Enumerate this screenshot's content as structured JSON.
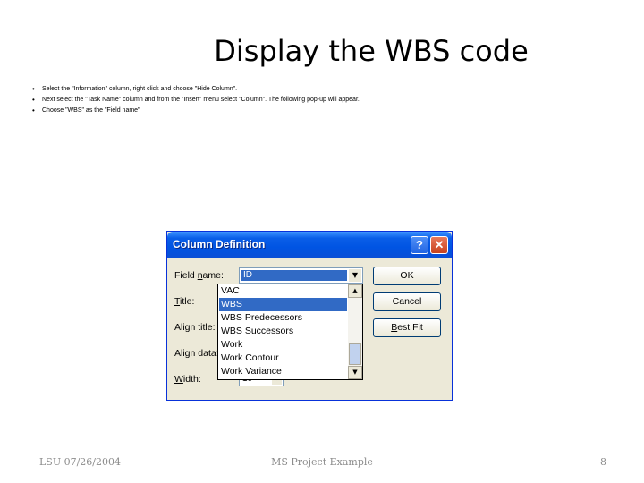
{
  "slide": {
    "title": "Display the WBS code",
    "bullets": [
      "Select the \"Information\" column, right click and choose \"Hide Column\".",
      "Next select the \"Task Name\" column and from the \"Insert\" menu select \"Column\".  The following pop-up will appear.",
      "Choose \"WBS\" as the \"Field name\""
    ],
    "footer_left": "LSU 07/26/2004",
    "footer_center": "MS Project Example",
    "footer_right": "8"
  },
  "dialog": {
    "title": "Column Definition",
    "help_glyph": "?",
    "close_glyph": "✕",
    "labels": {
      "field_name_pre": "Field ",
      "field_name_key": "n",
      "field_name_post": "ame:",
      "title_key": "T",
      "title_post": "itle:",
      "align_title_pre": "Align title:",
      "align_data_pre": "Align data:",
      "width_key": "W",
      "width_post": "idth:"
    },
    "field_name_value": "ID",
    "dropdown_items": [
      "VAC",
      "WBS",
      "WBS Predecessors",
      "WBS Successors",
      "Work",
      "Work Contour",
      "Work Variance"
    ],
    "selected_item": "WBS",
    "width_value": "10",
    "buttons": {
      "ok": "OK",
      "cancel": "Cancel",
      "best_fit_key": "B",
      "best_fit_post": "est Fit"
    }
  },
  "colors": {
    "titlebar": "#0054e3",
    "selection": "#316ac5",
    "dialog_bg": "#ece9d8"
  }
}
